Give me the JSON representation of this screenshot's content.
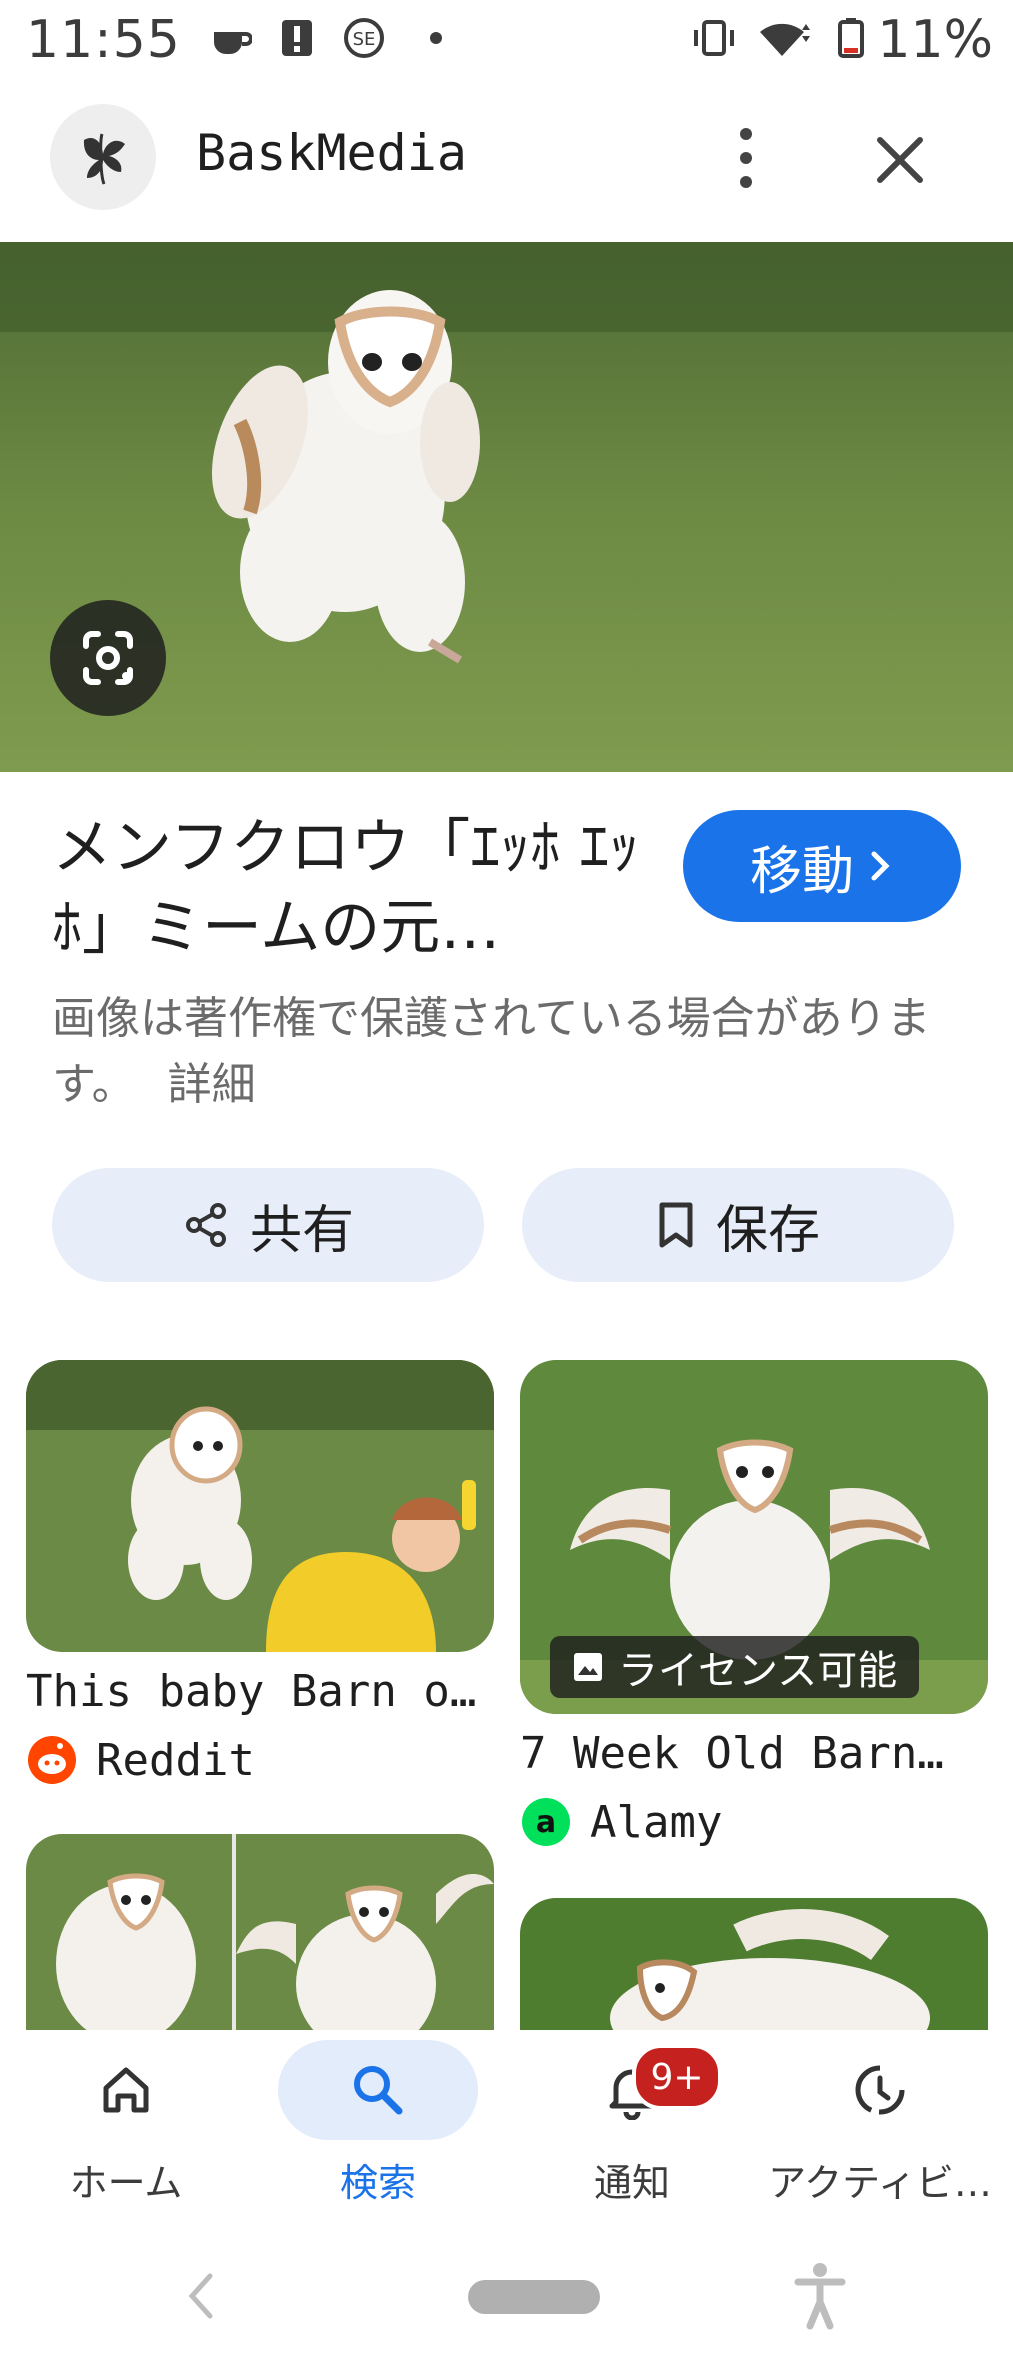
{
  "status_bar": {
    "time": "11:55",
    "battery": "11%"
  },
  "header": {
    "site_name": "BaskMedia"
  },
  "result": {
    "title": "メンフクロウ「ｴｯﾎ ｴｯﾎ」ミームの元…",
    "go_button": "移動",
    "copyright_notice": "画像は著作権で保護されている場合があります。",
    "details_link": "詳細",
    "share_button": "共有",
    "save_button": "保存"
  },
  "related": [
    {
      "title": "This baby Barn o…",
      "source": "Reddit"
    },
    {
      "title": "7 Week Old Barn…",
      "source": "Alamy",
      "badge": "ライセンス可能"
    }
  ],
  "bottom_nav": {
    "items": [
      {
        "label": "ホーム",
        "active": false
      },
      {
        "label": "検索",
        "active": true
      },
      {
        "label": "通知",
        "active": false
      },
      {
        "label": "アクティビ…",
        "active": false
      }
    ],
    "notification_badge": "9+"
  },
  "colors": {
    "accent": "#1a73e8",
    "pill_bg": "#e8eef9",
    "badge": "#c5221f",
    "active_nav_bg": "#e3ecfb"
  }
}
